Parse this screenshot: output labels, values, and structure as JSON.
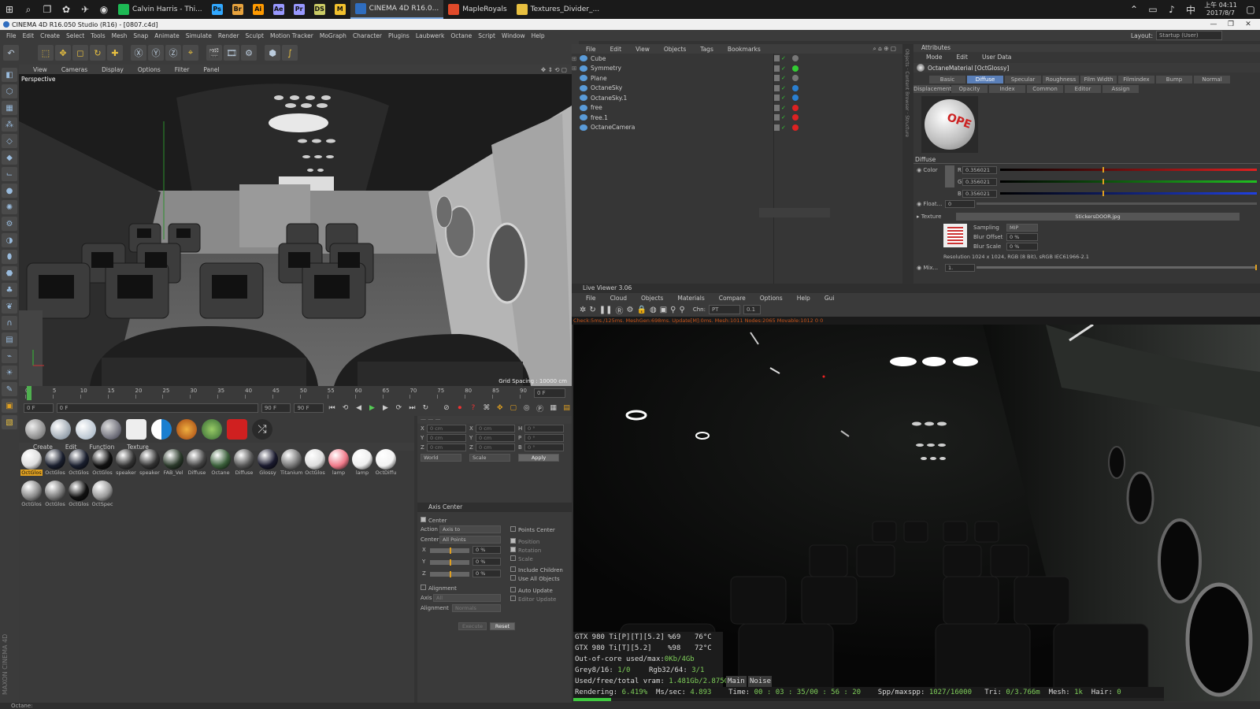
{
  "taskbar": {
    "apps": [
      {
        "label": "Calvin Harris - Thi...",
        "icon": "spotify-icon",
        "color": "#1db954"
      },
      {
        "label": "",
        "icon": "ps-icon",
        "color": "#31a8ff",
        "text": "Ps"
      },
      {
        "label": "",
        "icon": "br-icon",
        "color": "#e8a33d",
        "text": "Br"
      },
      {
        "label": "",
        "icon": "ai-icon",
        "color": "#ff9a00",
        "text": "Ai"
      },
      {
        "label": "",
        "icon": "ae-icon",
        "color": "#9999ff",
        "text": "Ae"
      },
      {
        "label": "",
        "icon": "pr-icon",
        "color": "#9999ff",
        "text": "Pr"
      },
      {
        "label": "",
        "icon": "ds-icon",
        "color": "#cccc66",
        "text": "DS"
      },
      {
        "label": "",
        "icon": "m-icon",
        "color": "#f2c12e",
        "text": "M"
      },
      {
        "label": "CINEMA 4D R16.0...",
        "icon": "c4d-icon",
        "color": "#2f6dbf",
        "active": true
      },
      {
        "label": "MapleRoyals",
        "icon": "maple-icon",
        "color": "#e04a2a"
      },
      {
        "label": "Textures_Divider_...",
        "icon": "folder-icon",
        "color": "#e8c040"
      }
    ],
    "clock_time": "上午 04:11",
    "clock_date": "2017/8/7"
  },
  "window": {
    "title": "CINEMA 4D R16.050 Studio (R16) - [0807.c4d]",
    "layout_label": "Layout:",
    "layout_value": "Startup (User)"
  },
  "menu": [
    "File",
    "Edit",
    "Create",
    "Select",
    "Tools",
    "Mesh",
    "Snap",
    "Animate",
    "Simulate",
    "Render",
    "Sculpt",
    "Motion Tracker",
    "MoGraph",
    "Character",
    "Plugins",
    "Laubwerk",
    "Octane",
    "Script",
    "Window",
    "Help"
  ],
  "viewport": {
    "menu": [
      "View",
      "Cameras",
      "Display",
      "Options",
      "Filter",
      "Panel"
    ],
    "label": "Perspective",
    "grid": "Grid Spacing : 10000 cm"
  },
  "timeline": {
    "ticks": [
      "0",
      "5",
      "10",
      "15",
      "20",
      "25",
      "30",
      "35",
      "40",
      "45",
      "50",
      "55",
      "60",
      "65",
      "70",
      "75",
      "80",
      "85",
      "90"
    ],
    "frame_right": "0 F",
    "start": "0 F",
    "current": "0 F",
    "end": "90 F",
    "end2": "90 F"
  },
  "materials": {
    "menu": [
      "Create",
      "Edit",
      "Function",
      "Texture"
    ],
    "items": [
      {
        "label": "OctGlos",
        "color": "#ddd",
        "sel": true
      },
      {
        "label": "OctGlos",
        "color": "#1a1f2e"
      },
      {
        "label": "OctGlos",
        "color": "#1a1f2e"
      },
      {
        "label": "OctGlos",
        "color": "#111"
      },
      {
        "label": "speaker",
        "color": "#333"
      },
      {
        "label": "speaker",
        "color": "#333"
      },
      {
        "label": "FAB_Vel",
        "color": "#2b3a2b"
      },
      {
        "label": "Diffuse",
        "color": "#444"
      },
      {
        "label": "Octane",
        "color": "#3a5f3a"
      },
      {
        "label": "Diffuse",
        "color": "#555"
      },
      {
        "label": "Glossy",
        "color": "#1a1a2e"
      },
      {
        "label": "Titanium",
        "color": "#777"
      },
      {
        "label": "OctGlos",
        "color": "#ddd"
      },
      {
        "label": "lamp",
        "color": "#f07a8a"
      },
      {
        "label": "lamp",
        "color": "#eee"
      },
      {
        "label": "OctDiffu",
        "color": "#f3f3f3"
      },
      {
        "label": "OctGlos",
        "color": "#888"
      },
      {
        "label": "OctGlos",
        "color": "#777"
      },
      {
        "label": "OctGlos",
        "color": "#111"
      },
      {
        "label": "OctSpec",
        "color": "#999"
      }
    ]
  },
  "coords": {
    "rows": [
      {
        "a": "X",
        "av": "0 cm",
        "b": "X",
        "bv": "0 cm",
        "c": "H",
        "cv": "0 °"
      },
      {
        "a": "Y",
        "av": "0 cm",
        "b": "Y",
        "bv": "0 cm",
        "c": "P",
        "cv": "0 °"
      },
      {
        "a": "Z",
        "av": "0 cm",
        "b": "Z",
        "bv": "0 cm",
        "c": "B",
        "cv": "0 °"
      }
    ],
    "mode1": "World",
    "mode2": "Scale",
    "apply": "Apply"
  },
  "axis": {
    "title": "Axis Center",
    "center_label": "Center",
    "action_label": "Action",
    "action_value": "Axis to",
    "center_sel_label": "Center",
    "center_sel_value": "All Points",
    "xyz": [
      {
        "k": "X",
        "v": "0 %"
      },
      {
        "k": "Y",
        "v": "0 %"
      },
      {
        "k": "Z",
        "v": "0 %"
      }
    ],
    "points_center": "Points Center",
    "position": "Position",
    "rotation": "Rotation",
    "scale": "Scale",
    "include_children": "Include Children",
    "use_all_objects": "Use All Objects",
    "alignment": "Alignment",
    "axis_label": "Axis",
    "axis_value": "All",
    "alignment_label": "Alignment",
    "alignment_value": "Normals",
    "auto_update": "Auto Update",
    "editor_update": "Editor Update",
    "execute": "Execute",
    "reset": "Reset"
  },
  "objects": {
    "menu": [
      "File",
      "Edit",
      "View",
      "Objects",
      "Tags",
      "Bookmarks"
    ],
    "rows": [
      "Cube",
      "Symmetry",
      "Plane",
      "OctaneSky",
      "OctaneSky.1",
      "free",
      "free.1",
      "OctaneCamera"
    ]
  },
  "attributes": {
    "title": "Attributes",
    "menu": [
      "Mode",
      "Edit",
      "User Data"
    ],
    "material": "OctaneMaterial [OctGlossy]",
    "tabs1": [
      "Basic",
      "Diffuse",
      "Specular",
      "Roughness",
      "Film Width",
      "Filmindex",
      "Bump",
      "Normal"
    ],
    "tabs2": [
      "Displacement",
      "Opacity",
      "Index",
      "Common",
      "Editor",
      "Assign"
    ],
    "section": "Diffuse",
    "color_label": "Color",
    "r_label": "R",
    "r": "0.356021",
    "g_label": "G",
    "g": "0.356021",
    "b_label": "B",
    "b": "0.356021",
    "float_label": "Float...",
    "float_value": "0",
    "texture_label": "Texture",
    "texture_file": "StickersDOOR.jpg",
    "sampling_label": "Sampling",
    "sampling_value": "MIP",
    "blur_offset_label": "Blur Offset",
    "blur_offset": "0 %",
    "blur_scale_label": "Blur Scale",
    "blur_scale": "0 %",
    "resolution": "Resolution 1024 x 1024, RGB (8 Bit), sRGB IEC61966-2.1",
    "mix_label": "Mix...",
    "mix_value": "1.",
    "preview_text": "OPE"
  },
  "live": {
    "title": "Live Viewer 3.06",
    "menu": [
      "File",
      "Cloud",
      "Objects",
      "Materials",
      "Compare",
      "Options",
      "Help",
      "Gui"
    ],
    "chn_label": "Chn:",
    "chn_value": "PT",
    "chn_num": "0.1",
    "check": "Check:5ms./125ms. MeshGen:698ms. Update[M]:0ms. Mesh:1011 Nodes:2065 Movable:1012  0 0",
    "gpu1": "GTX 980 Ti[P][T][5.2]",
    "gpu1_pct": "%69",
    "gpu1_temp": "76°C",
    "gpu2": "GTX 980 Ti[T][5.2]",
    "gpu2_pct": "%98",
    "gpu2_temp": "72°C",
    "ooc_label": "Out-of-core used/max:",
    "ooc_value": "0Kb/4Gb",
    "grey_label": "Grey8/16: ",
    "grey_value": "1/0",
    "rgb_label": "Rgb32/64: ",
    "rgb_value": "3/1",
    "vram_label": "Used/free/total vram: ",
    "vram_value": "1.481Gb/2.875Gb/6G",
    "main_btn": "Main",
    "noise_btn": "Noise",
    "rendering_label": "Rendering: ",
    "rendering_value": "6.419%",
    "mss_label": "Ms/sec: ",
    "mss_value": "4.893",
    "time_label": "Time: ",
    "time_value": "00 : 03 : 35/00 : 56 : 20",
    "spp_label": "Spp/maxspp: ",
    "spp_value": "1027/16000",
    "tri_label": "Tri: ",
    "tri_value": "0/3.766m",
    "mesh_label": "Mesh: ",
    "mesh_value": "1k",
    "hair_label": "Hair: ",
    "hair_value": "0",
    "progress": 0.064
  },
  "status": {
    "text": "Octane:"
  },
  "colors": {
    "accent": "#5a7fb8",
    "highlight": "#e0a020",
    "red": "#e02020",
    "green": "#20c020",
    "blue": "#2040e0"
  }
}
